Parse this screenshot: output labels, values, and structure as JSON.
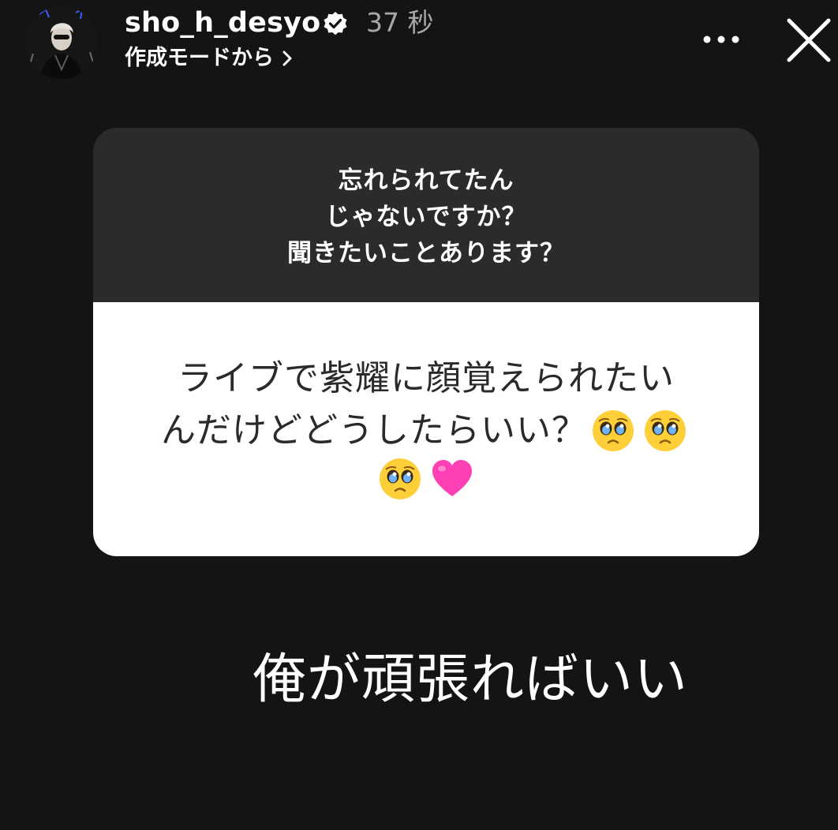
{
  "header": {
    "avatar_icon": "profile-photo",
    "username": "sho_h_desyo",
    "verified_icon": "verified-badge-icon",
    "time_ago": "37 秒",
    "source_link": "作成モードから",
    "more_icon": "more-horizontal-icon",
    "close_icon": "close-icon"
  },
  "question_card": {
    "prompt_lines": [
      "忘れられてたん",
      "じゃないですか？",
      "聞きたいことあります？"
    ],
    "answer_line_1": "ライブで紫耀に顔覚えられたい",
    "answer_line_2": "んだけどどうしたらいい？",
    "answer_emojis": [
      "pleading-face-emoji",
      "pleading-face-emoji",
      "pleading-face-emoji",
      "pink-heart-emoji"
    ]
  },
  "reply_text": "俺が頑張ればいい",
  "colors": {
    "background": "#141414",
    "question_bg": "#2b2b2b",
    "answer_bg": "#ffffff",
    "time_text": "#a8a8a8",
    "heart": "#ff3fb4"
  }
}
